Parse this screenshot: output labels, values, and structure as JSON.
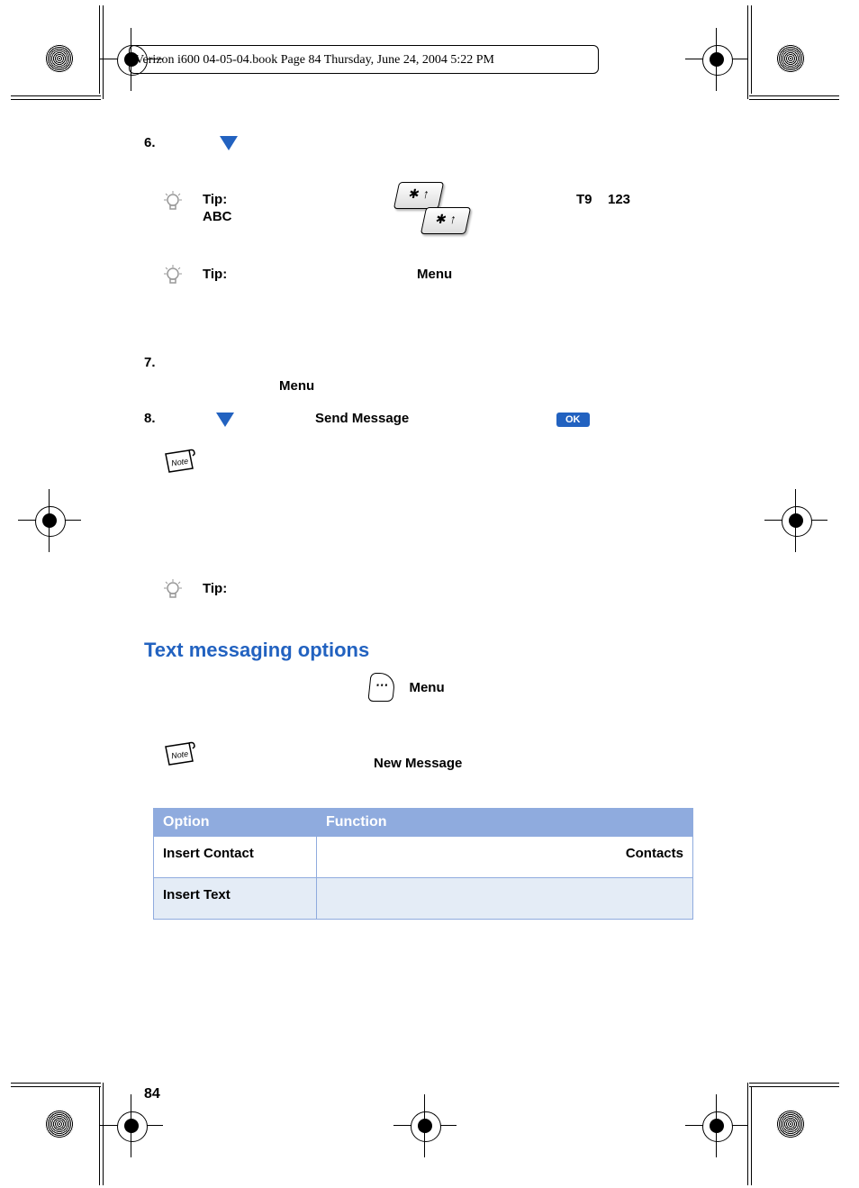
{
  "header": {
    "page_info": "Verizon i600 04-05-04.book  Page 84  Thursday, June 24, 2004  5:22 PM"
  },
  "steps": {
    "s6": "6.",
    "s7": "7.",
    "s8": "8."
  },
  "tips": {
    "label1": "Tip:",
    "label2": "Tip:",
    "label3": "Tip:",
    "abc": "ABC",
    "t9": "T9",
    "n123": "123"
  },
  "labels": {
    "menu1": "Menu",
    "menu2": "Menu",
    "menu3": "Menu",
    "send_message": "Send Message",
    "new_message": "New Message"
  },
  "buttons": {
    "ok": "OK"
  },
  "section": {
    "title": "Text messaging options"
  },
  "table": {
    "header_option": "Option",
    "header_function": "Function",
    "row1_option": "Insert Contact",
    "row1_function": "Contacts",
    "row2_option": "Insert Text"
  },
  "page_number": "84"
}
